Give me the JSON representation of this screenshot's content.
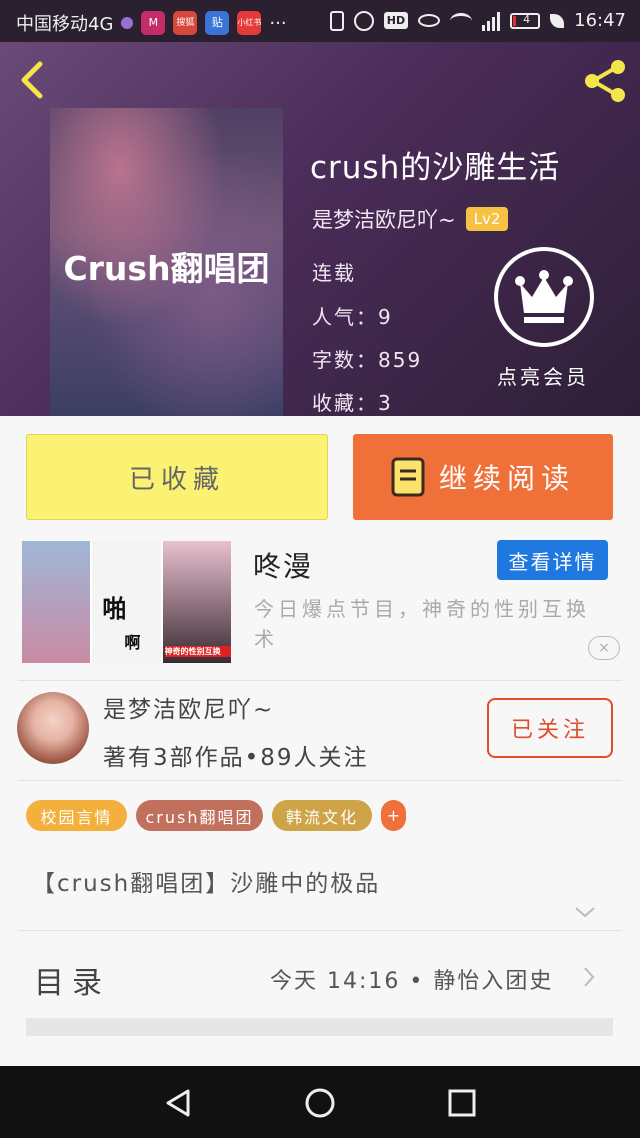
{
  "status_bar": {
    "carrier": "中国移动4G",
    "app_icons": [
      "M",
      "搜狐",
      "贴",
      "小红书"
    ],
    "more": "···",
    "battery": "4",
    "time": "16:47"
  },
  "book": {
    "cover_text": "Crush翻唱团",
    "title": "crush的沙雕生活",
    "author": "是梦洁欧尼吖~",
    "level": "Lv2",
    "status": "连载",
    "popularity": "人气：9",
    "word_count": "字数：859",
    "favorites": "收藏：3",
    "vip_label": "点亮会员"
  },
  "actions": {
    "favorited_label": "已收藏",
    "continue_label": "继续阅读"
  },
  "ad": {
    "name": "咚漫",
    "detail_button": "查看详情",
    "description": "今日爆点节目，神奇的性别互换术",
    "panel_texts": [
      "啪",
      "啊",
      "神奇的性别互换"
    ],
    "close": "×"
  },
  "author_card": {
    "name": "是梦洁欧尼吖~",
    "stats": "著有3部作品•89人关注",
    "follow_label": "已关注"
  },
  "tags": [
    {
      "label": "校园言情",
      "color": "#f4b03c"
    },
    {
      "label": "crush翻唱团",
      "color": "#c0705d"
    },
    {
      "label": "韩流文化",
      "color": "#cfa448"
    },
    {
      "label": "+",
      "color": "#f0703a"
    }
  ],
  "description": "【crush翻唱团】沙雕中的极品",
  "toc": {
    "label": "目录",
    "latest": "今天 14:16 • 静怡入团史"
  }
}
